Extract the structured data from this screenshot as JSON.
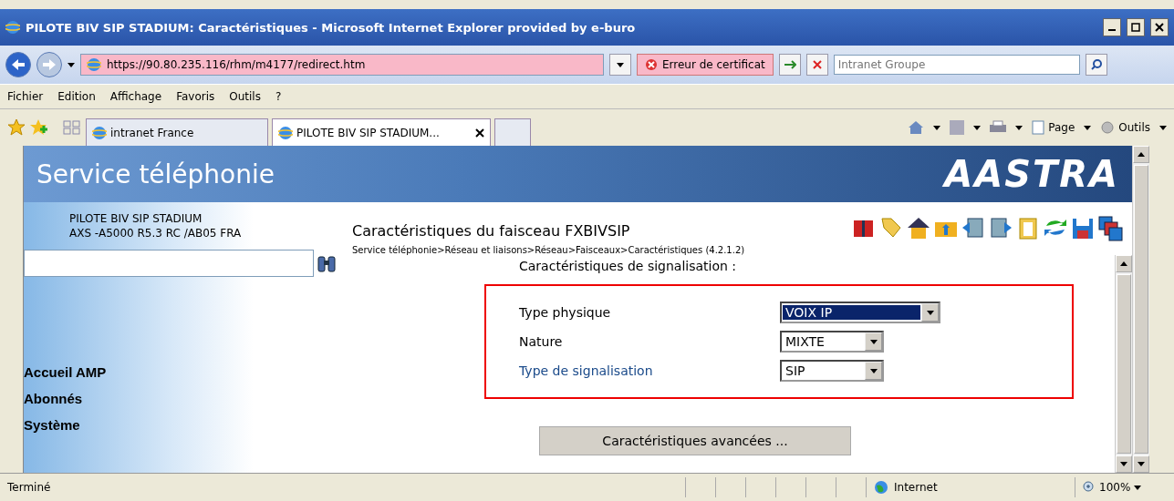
{
  "window": {
    "title": "PILOTE BIV SIP STADIUM: Caractéristiques - Microsoft Internet Explorer provided by e-buro"
  },
  "address_bar": {
    "url": "https://90.80.235.116/rhm/m4177/redirect.htm",
    "certificate_error": "Erreur de certificat",
    "search_placeholder": "Intranet Groupe"
  },
  "menu": [
    "Fichier",
    "Edition",
    "Affichage",
    "Favoris",
    "Outils",
    "?"
  ],
  "tabs": [
    {
      "label": "intranet France",
      "selected": false
    },
    {
      "label": "PILOTE BIV SIP STADIUM...",
      "selected": true
    }
  ],
  "command_bar": [
    "Page",
    "Outils"
  ],
  "banner": {
    "title": "Service téléphonie",
    "logo": "AASTRA"
  },
  "sidebar": {
    "system_name": "PILOTE BIV SIP STADIUM",
    "version": "AXS -A5000 R5.3 RC /AB05 FRA",
    "nav": [
      "Accueil AMP",
      "Abonnés",
      "Système"
    ]
  },
  "content": {
    "title": "Caractéristiques du faisceau FXBIVSIP",
    "breadcrumb": "Service téléphonie>Réseau et liaisons>Réseau>Faisceaux>Caractéristiques (4.2.1.2)",
    "section": "Caractéristiques de signalisation :",
    "fields": [
      {
        "label": "Type physique",
        "kind": "text",
        "value": "VOIX IP",
        "selected": true,
        "wide": true
      },
      {
        "label": "Nature",
        "kind": "text",
        "value": "MIXTE",
        "selected": false,
        "wide": false
      },
      {
        "label": "Type de signalisation",
        "kind": "link",
        "value": "SIP",
        "selected": false,
        "wide": false
      }
    ],
    "button": "Caractéristiques avancées ..."
  },
  "status_bar": {
    "text": "Terminé",
    "zone": "Internet",
    "zoom": "100%"
  }
}
